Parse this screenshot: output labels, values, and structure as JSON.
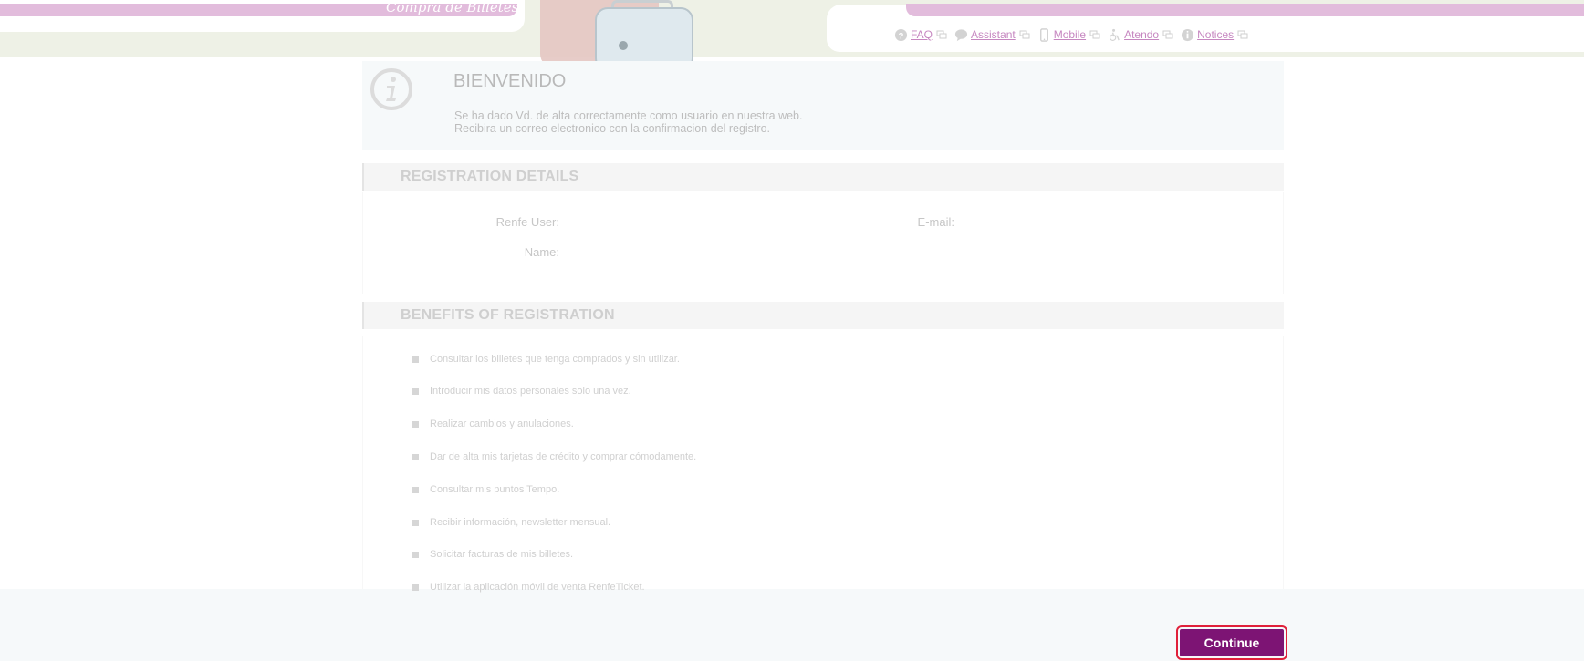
{
  "header": {
    "slogan": "Compra de Billetes",
    "nav": [
      {
        "label": "FAQ",
        "icon": "question-icon"
      },
      {
        "label": "Assistant",
        "icon": "chat-bubble-icon"
      },
      {
        "label": "Mobile",
        "icon": "mobile-phone-icon"
      },
      {
        "label": "Atendo",
        "icon": "accessibility-icon"
      },
      {
        "label": "Notices",
        "icon": "info-circle-icon"
      }
    ]
  },
  "welcome": {
    "icon": "info-icon",
    "title": "BIENVENIDO",
    "line1": "Se ha dado Vd. de alta correctamente como usuario en nuestra web.",
    "line2": "Recibira un correo electronico con la confirmacion del registro."
  },
  "registration": {
    "title": "REGISTRATION DETAILS",
    "renfe_user_label": "Renfe User:",
    "email_label": "E-mail:",
    "name_label": "Name:"
  },
  "benefits": {
    "title": "BENEFITS OF REGISTRATION",
    "items": [
      "Consultar los billetes que tenga comprados y sin utilizar.",
      "Introducir mis datos personales solo una vez.",
      "Realizar cambios y anulaciones.",
      "Dar de alta mis tarjetas de crédito y comprar cómodamente.",
      "Consultar mis puntos Tempo.",
      "Recibir información, newsletter mensual.",
      "Solicitar facturas de mis billetes.",
      "Utilizar la aplicación móvil de venta RenfeTicket."
    ]
  },
  "footer": {
    "continue_label": "Continue"
  },
  "colors": {
    "accent": "#7d1474",
    "highlight": "#e0213a",
    "nav_link": "#c686c0",
    "header_pink": "#e2bcdc"
  }
}
